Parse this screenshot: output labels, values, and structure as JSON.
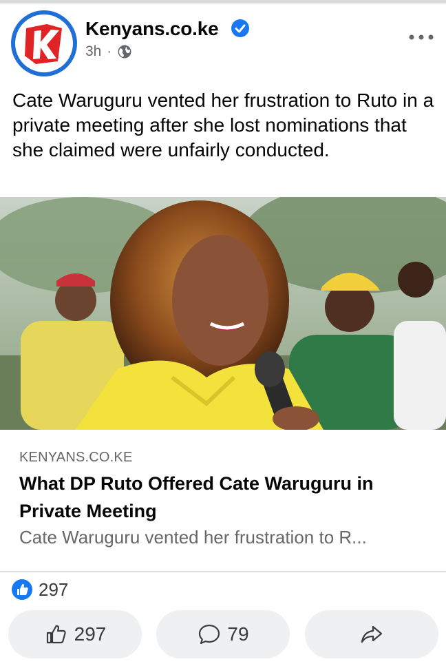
{
  "post": {
    "author": "Kenyans.co.ke",
    "time": "3h",
    "separator": "·",
    "caption": "Cate Waruguru vented her frustration to Ruto in a private meeting after she lost nominations that she claimed were unfairly conducted."
  },
  "link": {
    "domain": "KENYANS.CO.KE",
    "title": "What DP Ruto Offered Cate Waruguru in Private Meeting",
    "description": "Cate Waruguru vented her frustration to R..."
  },
  "reactions": {
    "count": "297",
    "icon": "like-reaction-icon"
  },
  "actions": {
    "like_count": "297",
    "comment_count": "79"
  },
  "colors": {
    "brand_blue": "#1877f2",
    "logo_red": "#e02426",
    "secondary_text": "#65676b",
    "button_bg": "#eff0f2"
  }
}
